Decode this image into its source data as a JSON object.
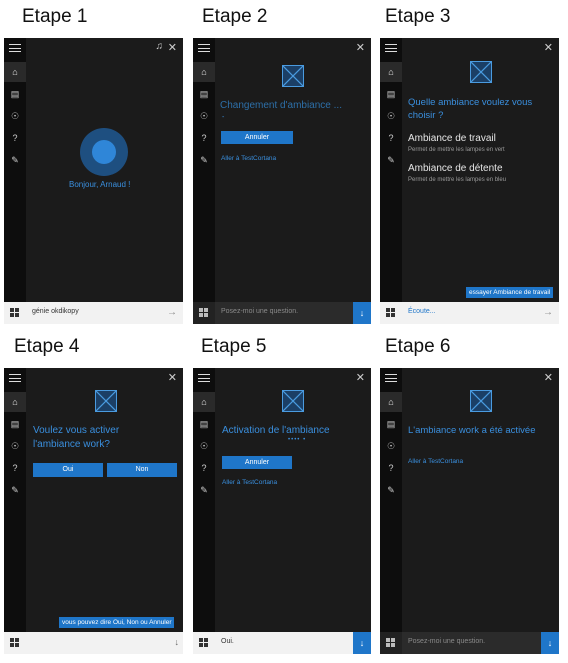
{
  "steps": [
    {
      "title": "Etape 1",
      "greeting": "Bonjour, Arnaud !",
      "search_text": "génie okdikopy"
    },
    {
      "title": "Etape 2",
      "status": "Changement d'ambiance ...",
      "dot": "-",
      "button": "Annuler",
      "link": "Aller à TestCortana",
      "search_placeholder": "Posez-moi une question."
    },
    {
      "title": "Etape 3",
      "question": "Quelle ambiance voulez vous choisir ?",
      "options": [
        {
          "label": "Ambiance de travail",
          "desc": "Permet de mettre les lampes en vert"
        },
        {
          "label": "Ambiance de détente",
          "desc": "Permet de mettre les lampes en bleu"
        }
      ],
      "tooltip": "essayer Ambiance de travail",
      "search_text": "Écoute..."
    },
    {
      "title": "Etape 4",
      "question_line1": "Voulez vous activer",
      "question_line2": "l'ambiance work?",
      "yes": "Oui",
      "no": "Non",
      "tooltip": "vous pouvez dire Oui, Non ou Annuler"
    },
    {
      "title": "Etape 5",
      "status": "Activation de l'ambiance",
      "dots": "••••  •",
      "button": "Annuler",
      "link": "Aller à TestCortana",
      "search_text": "Oui."
    },
    {
      "title": "Etape 6",
      "status": "L'ambiance work a été activée",
      "link": "Aller à TestCortana",
      "search_placeholder": "Posez-moi une question."
    }
  ],
  "icons": {
    "home": "⌂",
    "notebook": "▤",
    "bulb": "☉",
    "help": "?",
    "feedback": "✎",
    "close": "✕",
    "music": "♫",
    "mic": "↓",
    "arrow": "→"
  },
  "colors": {
    "accent": "#1f76c9",
    "panel": "#1b1b1b",
    "sidebar": "#0d0d0d",
    "blue_text": "#3a8fde"
  }
}
